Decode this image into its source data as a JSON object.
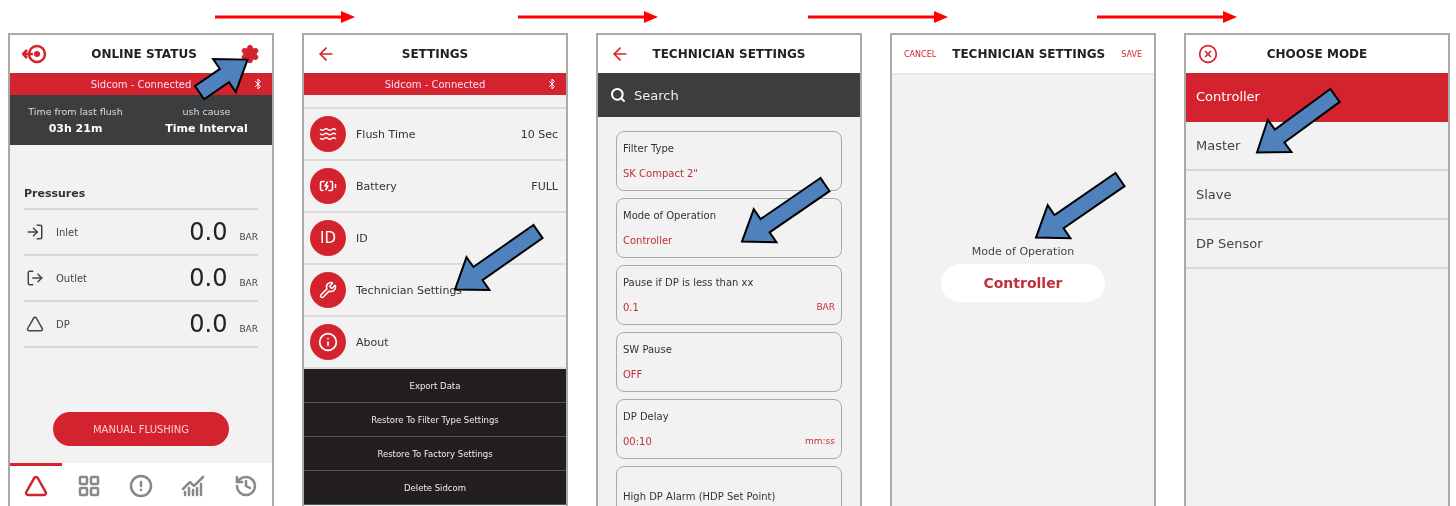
{
  "online_status": {
    "title": "ONLINE STATUS",
    "connection": "Sidcom - Connected",
    "stats": [
      {
        "label": "Time from last flush",
        "value": "03h 21m"
      },
      {
        "label": "ush cause",
        "value": "Time Interval"
      }
    ],
    "section": "Pressures",
    "pressures": [
      {
        "kind": "in",
        "label": "Inlet",
        "value": "0.0",
        "unit": "BAR"
      },
      {
        "kind": "out",
        "label": "Outlet",
        "value": "0.0",
        "unit": "BAR"
      },
      {
        "kind": "delta",
        "label": "DP",
        "value": "0.0",
        "unit": "BAR"
      }
    ],
    "button": "MANUAL FLUSHING",
    "nav": [
      {
        "selected": true
      },
      {
        "selected": false
      },
      {
        "selected": false
      },
      {
        "selected": false
      },
      {
        "selected": false
      }
    ]
  },
  "settings": {
    "title": "SETTINGS",
    "connection": "Sidcom - Connected",
    "rows": [
      {
        "kind": "waves",
        "label": "Flush Time",
        "value": "10 Sec"
      },
      {
        "kind": "battery",
        "label": "Battery",
        "value": "FULL"
      },
      {
        "kind": "badge",
        "badge": "ID",
        "label": "ID"
      },
      {
        "kind": "tools",
        "label": "Technician Settings"
      },
      {
        "kind": "info",
        "label": "About"
      }
    ],
    "actions": [
      "Export Data",
      "Restore To Filter Type Settings",
      "Restore To Factory Settings",
      "Delete Sidcom"
    ]
  },
  "technician_settings": {
    "title": "TECHNICIAN SETTINGS",
    "search": {
      "placeholder": "Search"
    },
    "cards": [
      {
        "label": "Filter Type",
        "value": "SK Compact 2\""
      },
      {
        "label": "Mode of Operation",
        "value": "Controller"
      },
      {
        "label": "Pause if DP is less than xx",
        "value": "0.1",
        "unit": "BAR"
      },
      {
        "label": "SW Pause",
        "value": "OFF"
      },
      {
        "label": "DP Delay",
        "value": "00:10",
        "unit": "mm:ss"
      },
      {
        "label": "High DP Alarm (HDP Set Point)"
      }
    ]
  },
  "mode_edit": {
    "cancel": "CANCEL",
    "title": "TECHNICIAN SETTINGS",
    "save": "SAVE",
    "label": "Mode of Operation",
    "value": "Controller"
  },
  "choose_mode": {
    "title": "CHOOSE MODE",
    "options": [
      {
        "label": "Controller",
        "selected": true
      },
      {
        "label": "Master",
        "selected": false
      },
      {
        "label": "Slave",
        "selected": false
      },
      {
        "label": "DP Sensor",
        "selected": false
      }
    ]
  }
}
